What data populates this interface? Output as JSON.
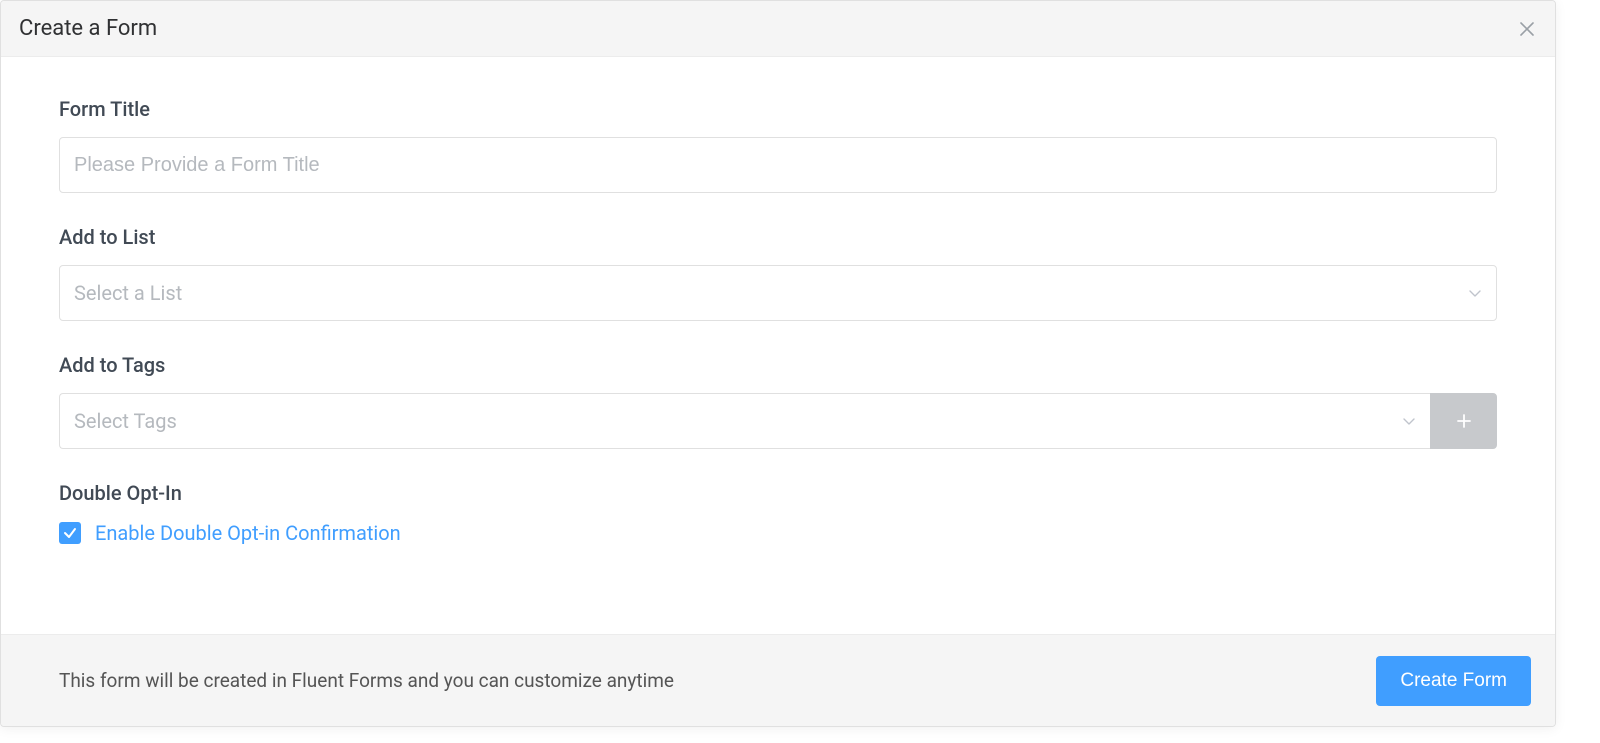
{
  "header": {
    "title": "Create a Form"
  },
  "form": {
    "title_label": "Form Title",
    "title_placeholder": "Please Provide a Form Title",
    "title_value": "",
    "list_label": "Add to List",
    "list_placeholder": "Select a List",
    "tags_label": "Add to Tags",
    "tags_placeholder": "Select Tags",
    "optin_label": "Double Opt-In",
    "optin_checkbox_label": "Enable Double Opt-in Confirmation",
    "optin_checked": true
  },
  "footer": {
    "hint": "This form will be created in Fluent Forms and you can customize anytime",
    "primary": "Create Form"
  },
  "icons": {
    "close": "close-icon",
    "chevron": "chevron-down-icon",
    "plus": "plus-icon",
    "check": "check-icon"
  },
  "colors": {
    "accent": "#409eff"
  }
}
